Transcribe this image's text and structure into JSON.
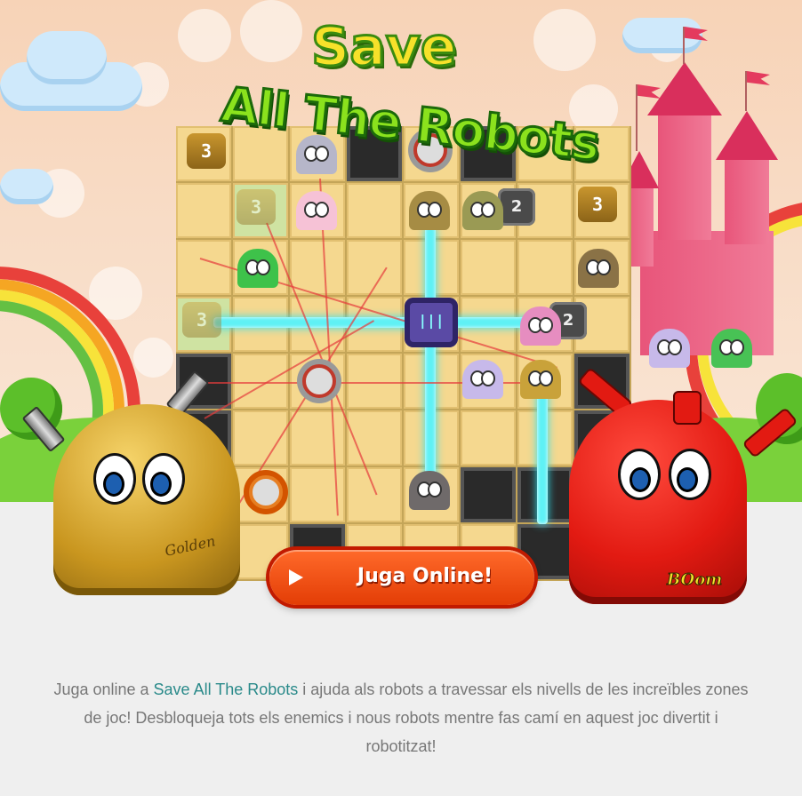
{
  "game": {
    "logo_line1": "Save",
    "logo_line2": "All The Robots"
  },
  "characters": {
    "golden_label": "Golden",
    "boom_label": "BOom"
  },
  "board": {
    "fist_number": "3",
    "block_number": "2"
  },
  "cta": {
    "play_label": "Juga Online!",
    "play_icon": "play-icon"
  },
  "description": {
    "prefix": "Juga online a ",
    "link_text": "Save All The Robots",
    "suffix": " i ajuda als robots a travessar els nivells de les increïbles zones de joc! Desbloqueja tots els enemics i nous robots mentre fas camí en aquest joc divertit i robotitzat!"
  },
  "colors": {
    "hero_bg": "#f7d3b7",
    "page_bg": "#efefef",
    "button": "#f04a0c",
    "link": "#2a8a8a",
    "text": "#777777"
  }
}
